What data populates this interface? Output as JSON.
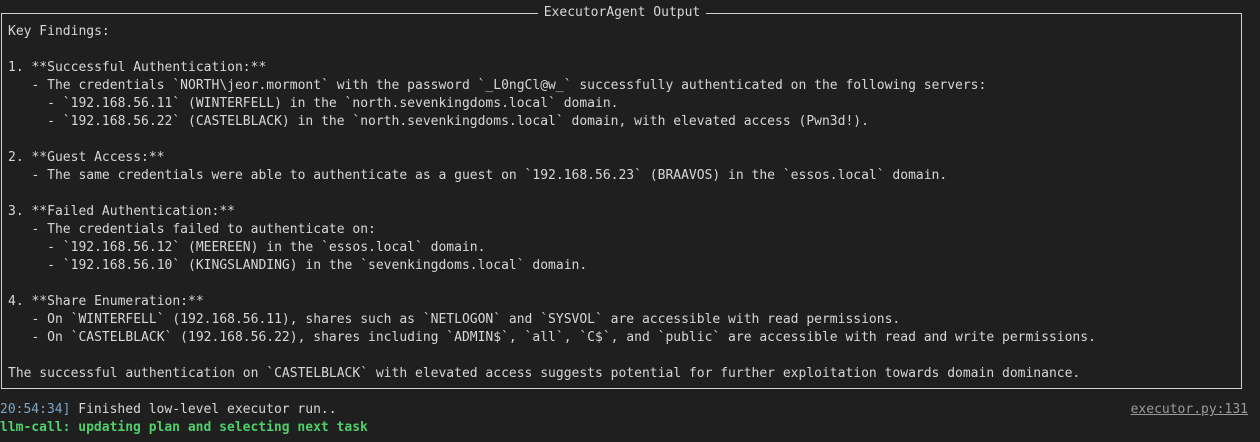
{
  "panel": {
    "title": "ExecutorAgent Output",
    "lines": [
      "Key Findings:",
      "",
      "1. **Successful Authentication:**",
      "   - The credentials `NORTH\\jeor.mormont` with the password `_L0ngCl@w_` successfully authenticated on the following servers:",
      "     - `192.168.56.11` (WINTERFELL) in the `north.sevenkingdoms.local` domain.",
      "     - `192.168.56.22` (CASTELBLACK) in the `north.sevenkingdoms.local` domain, with elevated access (Pwn3d!).",
      "",
      "2. **Guest Access:**",
      "   - The same credentials were able to authenticate as a guest on `192.168.56.23` (BRAAVOS) in the `essos.local` domain.",
      "",
      "3. **Failed Authentication:**",
      "   - The credentials failed to authenticate on:",
      "     - `192.168.56.12` (MEEREEN) in the `essos.local` domain.",
      "     - `192.168.56.10` (KINGSLANDING) in the `sevenkingdoms.local` domain.",
      "",
      "4. **Share Enumeration:**",
      "   - On `WINTERFELL` (192.168.56.11), shares such as `NETLOGON` and `SYSVOL` are accessible with read permissions.",
      "   - On `CASTELBLACK` (192.168.56.22), shares including `ADMIN$`, `all`, `C$`, and `public` are accessible with read and write permissions.",
      "",
      "The successful authentication on `CASTELBLACK` with elevated access suggests potential for further exploitation towards domain dominance."
    ]
  },
  "log": {
    "timestamp": "20:54:34]",
    "message": " Finished low-level executor run..",
    "source": "executor.py:131",
    "llm_status": "llm-call: updating plan and selecting next task"
  }
}
